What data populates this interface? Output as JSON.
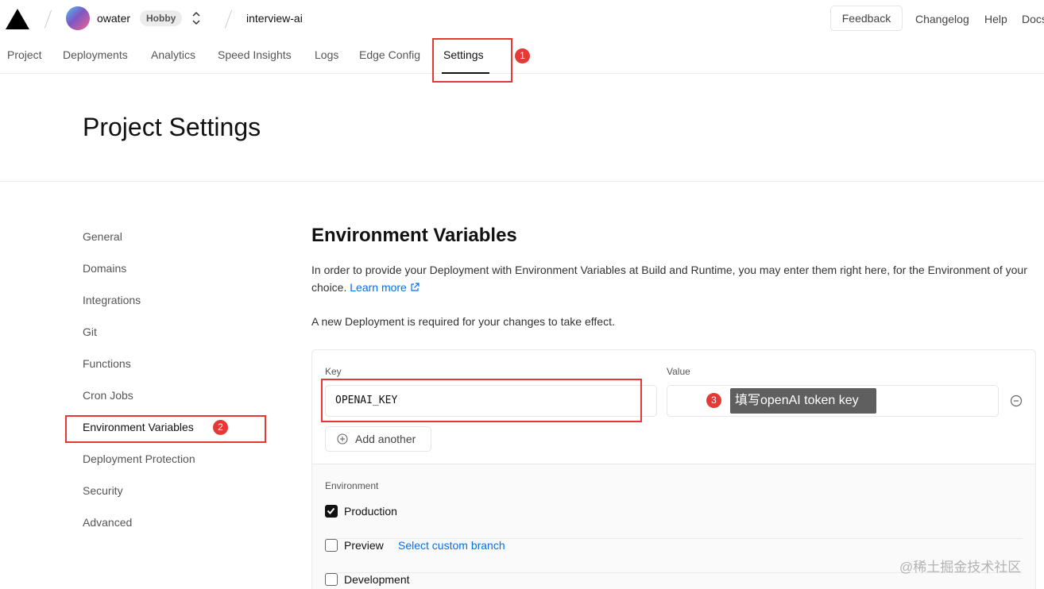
{
  "topbar": {
    "team_name": "owater",
    "plan_badge": "Hobby",
    "project_name": "interview-ai",
    "feedback_label": "Feedback",
    "links": [
      "Changelog",
      "Help",
      "Docs"
    ]
  },
  "tabs": [
    {
      "label": "Project"
    },
    {
      "label": "Deployments"
    },
    {
      "label": "Analytics"
    },
    {
      "label": "Speed Insights"
    },
    {
      "label": "Logs"
    },
    {
      "label": "Edge Config"
    },
    {
      "label": "Settings",
      "active": true
    }
  ],
  "page_title": "Project Settings",
  "sidebar": {
    "items": [
      {
        "label": "General"
      },
      {
        "label": "Domains"
      },
      {
        "label": "Integrations"
      },
      {
        "label": "Git"
      },
      {
        "label": "Functions"
      },
      {
        "label": "Cron Jobs"
      },
      {
        "label": "Environment Variables",
        "active": true
      },
      {
        "label": "Deployment Protection"
      },
      {
        "label": "Security"
      },
      {
        "label": "Advanced"
      }
    ]
  },
  "env": {
    "title": "Environment Variables",
    "description": "In order to provide your Deployment with Environment Variables at Build and Runtime, you may enter them right here, for the Environment of your choice.",
    "learn_more": "Learn more",
    "note": "A new Deployment is required for your changes to take effect.",
    "key_label": "Key",
    "key_value": "OPENAI_KEY",
    "value_label": "Value",
    "value_value": "",
    "add_another": "Add another",
    "environment_label": "Environment",
    "options": [
      {
        "label": "Production",
        "checked": true
      },
      {
        "label": "Preview",
        "checked": false,
        "link": "Select custom branch"
      },
      {
        "label": "Development",
        "checked": false
      }
    ]
  },
  "annotations": {
    "badge_1": "1",
    "badge_2": "2",
    "badge_3": "3",
    "tooltip": "填写openAI token key"
  },
  "watermark": "@稀土掘金技术社区",
  "colors": {
    "accent_red": "#e53935",
    "link_blue": "#0070f3",
    "tooltip_bg": "#5f5f5f"
  }
}
